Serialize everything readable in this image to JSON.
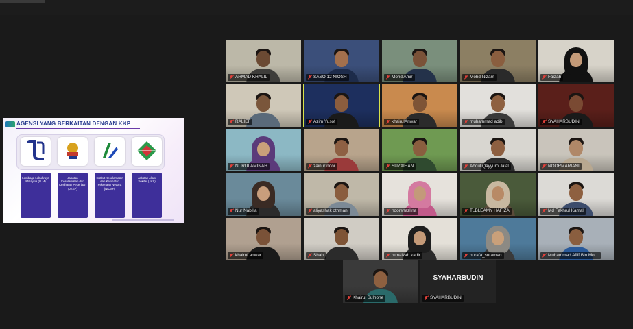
{
  "share": {
    "title": "AGENSI YANG BERKAITAN DENGAN KKP",
    "agencies": [
      {
        "label": "Lembaga Lebuhraya Malaysia (LLM)"
      },
      {
        "label": "Jabatan Keselamatan dan Kesihatan Pekerjaan (JKKP)"
      },
      {
        "label": "Institut Keselamatan dan Kesihatan Pekerjaan Negara (NIOSH)"
      },
      {
        "label": "Jabatan Alam Sekitar (JAS)"
      }
    ]
  },
  "participants": [
    {
      "name": "AHMAD KHALIL",
      "bg": "#bcb8a8",
      "skin": "#6b4a33",
      "shirt": "#3e3d3a",
      "style": "man"
    },
    {
      "name": "SASO 12 NIOSH",
      "bg": "#3b4f7a",
      "skin": "#a3704d",
      "shirt": "#1d2b4a",
      "style": "man"
    },
    {
      "name": "Mohd Amir",
      "bg": "#7a8f7c",
      "skin": "#7a5238",
      "shirt": "#24324a",
      "style": "man"
    },
    {
      "name": "Mohd Nizam",
      "bg": "#8c7f63",
      "skin": "#8a5e3f",
      "shirt": "#2a2a2a",
      "style": "man"
    },
    {
      "name": "Faizah",
      "bg": "#d7d3c9",
      "skin": "#c49a78",
      "shirt": "#111111",
      "style": "hijab",
      "hijab": "#111111"
    },
    {
      "name": "RALIEF",
      "bg": "#cfc8b8",
      "skin": "#7a563b",
      "shirt": "#5a6a7a",
      "style": "man"
    },
    {
      "name": "Azim Yusof",
      "bg": "#1d2f5e",
      "skin": "#8b5d3e",
      "shirt": "#1a1a1a",
      "style": "man",
      "active": true
    },
    {
      "name": "khairulAnwar",
      "bg": "#c98a4e",
      "skin": "#7e5436",
      "shirt": "#2b2b2b",
      "style": "man"
    },
    {
      "name": "muhammad adib",
      "bg": "#e2e0dc",
      "skin": "#8e6040",
      "shirt": "#3a3a3a",
      "style": "man"
    },
    {
      "name": "SYAHARBUDIN",
      "bg": "#5a1f1a",
      "skin": "#7a4a33",
      "shirt": "#1a1a1a",
      "style": "man"
    },
    {
      "name": "NURULAMINAH",
      "bg": "#8cb8c4",
      "skin": "#c9a07a",
      "shirt": "#5b3a7a",
      "style": "hijab",
      "hijab": "#5b3a7a"
    },
    {
      "name": "zainur noor",
      "bg": "#b8a48c",
      "skin": "#8e6043",
      "shirt": "#9a3a3a",
      "style": "man"
    },
    {
      "name": "SUZAIHAN",
      "bg": "#6f9a52",
      "skin": "#8a5e3f",
      "shirt": "#2f4a2f",
      "style": "man"
    },
    {
      "name": "Abdul Qayyum Jalal",
      "bg": "#d8d6d0",
      "skin": "#8d5f40",
      "shirt": "#2b2b2b",
      "style": "man"
    },
    {
      "name": "NOORMARIANI",
      "bg": "#c9c4bb",
      "skin": "#b08868",
      "shirt": "#b8a890",
      "style": "man"
    },
    {
      "name": "Nur Nabilla",
      "bg": "#6a8a9a",
      "skin": "#c89e7c",
      "shirt": "#2b2b2b",
      "style": "hijab",
      "hijab": "#3a2b24"
    },
    {
      "name": "aliyashak othman",
      "bg": "#bfb8a8",
      "skin": "#8a5d3e",
      "shirt": "#7c8a96",
      "style": "man"
    },
    {
      "name": "noorshazlina",
      "bg": "#e6e2dc",
      "skin": "#c39a7a",
      "shirt": "#c25a8a",
      "style": "hijab",
      "hijab": "#d47aa0"
    },
    {
      "name": "TLBLEAMY HAFIZA",
      "bg": "#4a5a3a",
      "skin": "#b88a66",
      "shirt": "#5a4a3a",
      "style": "hijab",
      "hijab": "#c8b8a0"
    },
    {
      "name": "Md Fakhrul Kamal",
      "bg": "#dcdad6",
      "skin": "#8e6040",
      "shirt": "#3c4c6c",
      "style": "man"
    },
    {
      "name": "khairul anwar",
      "bg": "#b0a090",
      "skin": "#7a5238",
      "shirt": "#1a1a1a",
      "style": "man"
    },
    {
      "name": "Shah",
      "bg": "#d0ccc4",
      "skin": "#7e5436",
      "shirt": "#2b2b2b",
      "style": "man"
    },
    {
      "name": "rumaizah kadir",
      "bg": "#e4e0d8",
      "skin": "#c49a78",
      "shirt": "#2b2b2b",
      "style": "hijab",
      "hijab": "#1e1e1e"
    },
    {
      "name": "nurafa_suraman",
      "bg": "#4e7a9a",
      "skin": "#c9a07a",
      "shirt": "#3a3a3a",
      "style": "hijab",
      "hijab": "#8c8a84"
    },
    {
      "name": "Muhammad Afiff Bin Mol...",
      "bg": "#a8b0b8",
      "skin": "#8a5e3f",
      "shirt": "#2a5a9a",
      "style": "man"
    }
  ],
  "bottom_row": [
    {
      "name": "Khairul Sulhone",
      "bg": "#3a3a3a",
      "skin": "#8e6040",
      "shirt": "#2a6a6a",
      "style": "man"
    },
    {
      "name": "SYAHARBUDIN",
      "label": "SYAHARBUDIN"
    }
  ]
}
